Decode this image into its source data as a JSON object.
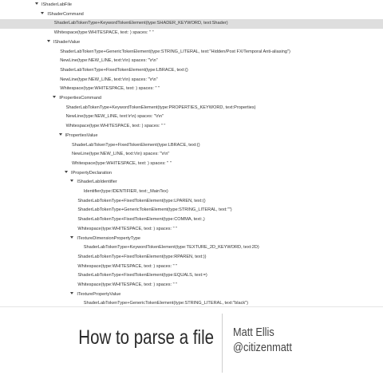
{
  "tree": {
    "nodes": [
      {
        "text": "IShaderLabFile",
        "level": 0,
        "expanded": true,
        "selected": false
      },
      {
        "text": "IShaderCommand",
        "level": 1,
        "expanded": true,
        "selected": false
      },
      {
        "text": "ShaderLabTokenType+KeywordTokenElement(type:SHADER_KEYWORD, text:Shader)",
        "level": 2,
        "expanded": false,
        "selected": true
      },
      {
        "text": "Whitespace(type:WHITESPACE, text: ) spaces: \" \"",
        "level": 2,
        "expanded": false,
        "selected": false
      },
      {
        "text": "IShaderValue",
        "level": 2,
        "expanded": true,
        "selected": false
      },
      {
        "text": "ShaderLabTokenType+GenericTokenElement(type:STRING_LITERAL, text:\"Hidden/Post FX/Temporal Anti-aliasing\")",
        "level": 3,
        "expanded": false,
        "selected": false
      },
      {
        "text": "NewLine(type:NEW_LINE, text:\\r\\n) spaces: \"\\r\\n\"",
        "level": 3,
        "expanded": false,
        "selected": false
      },
      {
        "text": "ShaderLabTokenType+FixedTokenElement(type:LBRACE, text:{)",
        "level": 3,
        "expanded": false,
        "selected": false
      },
      {
        "text": "NewLine(type:NEW_LINE, text:\\r\\n) spaces: \"\\r\\n\"",
        "level": 3,
        "expanded": false,
        "selected": false
      },
      {
        "text": "Whitespace(type:WHITESPACE, text: ) spaces: \" \"",
        "level": 3,
        "expanded": false,
        "selected": false
      },
      {
        "text": "IPropertiesCommand",
        "level": 3,
        "expanded": true,
        "selected": false
      },
      {
        "text": "ShaderLabTokenType+KeywordTokenElement(type:PROPERTIES_KEYWORD, text:Properties)",
        "level": 4,
        "expanded": false,
        "selected": false
      },
      {
        "text": "NewLine(type:NEW_LINE, text:\\r\\n) spaces: \"\\r\\n\"",
        "level": 4,
        "expanded": false,
        "selected": false
      },
      {
        "text": "Whitespace(type:WHITESPACE, text: ) spaces: \" \"",
        "level": 4,
        "expanded": false,
        "selected": false
      },
      {
        "text": "IPropertiesValue",
        "level": 4,
        "expanded": true,
        "selected": false
      },
      {
        "text": "ShaderLabTokenType+FixedTokenElement(type:LBRACE, text:{)",
        "level": 5,
        "expanded": false,
        "selected": false
      },
      {
        "text": "NewLine(type:NEW_LINE, text:\\r\\n) spaces: \"\\r\\n\"",
        "level": 5,
        "expanded": false,
        "selected": false
      },
      {
        "text": "Whitespace(type:WHITESPACE, text: ) spaces: \" \"",
        "level": 5,
        "expanded": false,
        "selected": false
      },
      {
        "text": "IPropertyDeclaration",
        "level": 5,
        "expanded": true,
        "selected": false
      },
      {
        "text": "IShaderLabIdentifier",
        "level": 6,
        "expanded": true,
        "selected": false
      },
      {
        "text": "Identifier(type:IDENTIFIER, text:_MainTex)",
        "level": 7,
        "expanded": false,
        "selected": false
      },
      {
        "text": "ShaderLabTokenType+FixedTokenElement(type:LPAREN, text:()",
        "level": 6,
        "expanded": false,
        "selected": false
      },
      {
        "text": "ShaderLabTokenType+GenericTokenElement(type:STRING_LITERAL, text:\"\")",
        "level": 6,
        "expanded": false,
        "selected": false
      },
      {
        "text": "ShaderLabTokenType+FixedTokenElement(type:COMMA, text:,)",
        "level": 6,
        "expanded": false,
        "selected": false
      },
      {
        "text": "Whitespace(type:WHITESPACE, text: ) spaces: \" \"",
        "level": 6,
        "expanded": false,
        "selected": false
      },
      {
        "text": "ITextureDimensionPropertyType",
        "level": 6,
        "expanded": true,
        "selected": false
      },
      {
        "text": "ShaderLabTokenType+KeywordTokenElement(type:TEXTURE_2D_KEYWORD, text:2D)",
        "level": 7,
        "expanded": false,
        "selected": false
      },
      {
        "text": "ShaderLabTokenType+FixedTokenElement(type:RPAREN, text:))",
        "level": 6,
        "expanded": false,
        "selected": false
      },
      {
        "text": "Whitespace(type:WHITESPACE, text: ) spaces: \" \"",
        "level": 6,
        "expanded": false,
        "selected": false
      },
      {
        "text": "ShaderLabTokenType+FixedTokenElement(type:EQUALS, text:=)",
        "level": 6,
        "expanded": false,
        "selected": false
      },
      {
        "text": "Whitespace(type:WHITESPACE, text: ) spaces: \" \"",
        "level": 6,
        "expanded": false,
        "selected": false
      },
      {
        "text": "ITexturePropertyValue",
        "level": 6,
        "expanded": true,
        "selected": false
      },
      {
        "text": "ShaderLabTokenType+GenericTokenElement(type:STRING_LITERAL, text:\"black\")",
        "level": 7,
        "expanded": false,
        "selected": false
      }
    ]
  },
  "footer": {
    "title": "How to parse a file",
    "speaker_name": "Matt Ellis",
    "speaker_handle": "@citizenmatt"
  }
}
